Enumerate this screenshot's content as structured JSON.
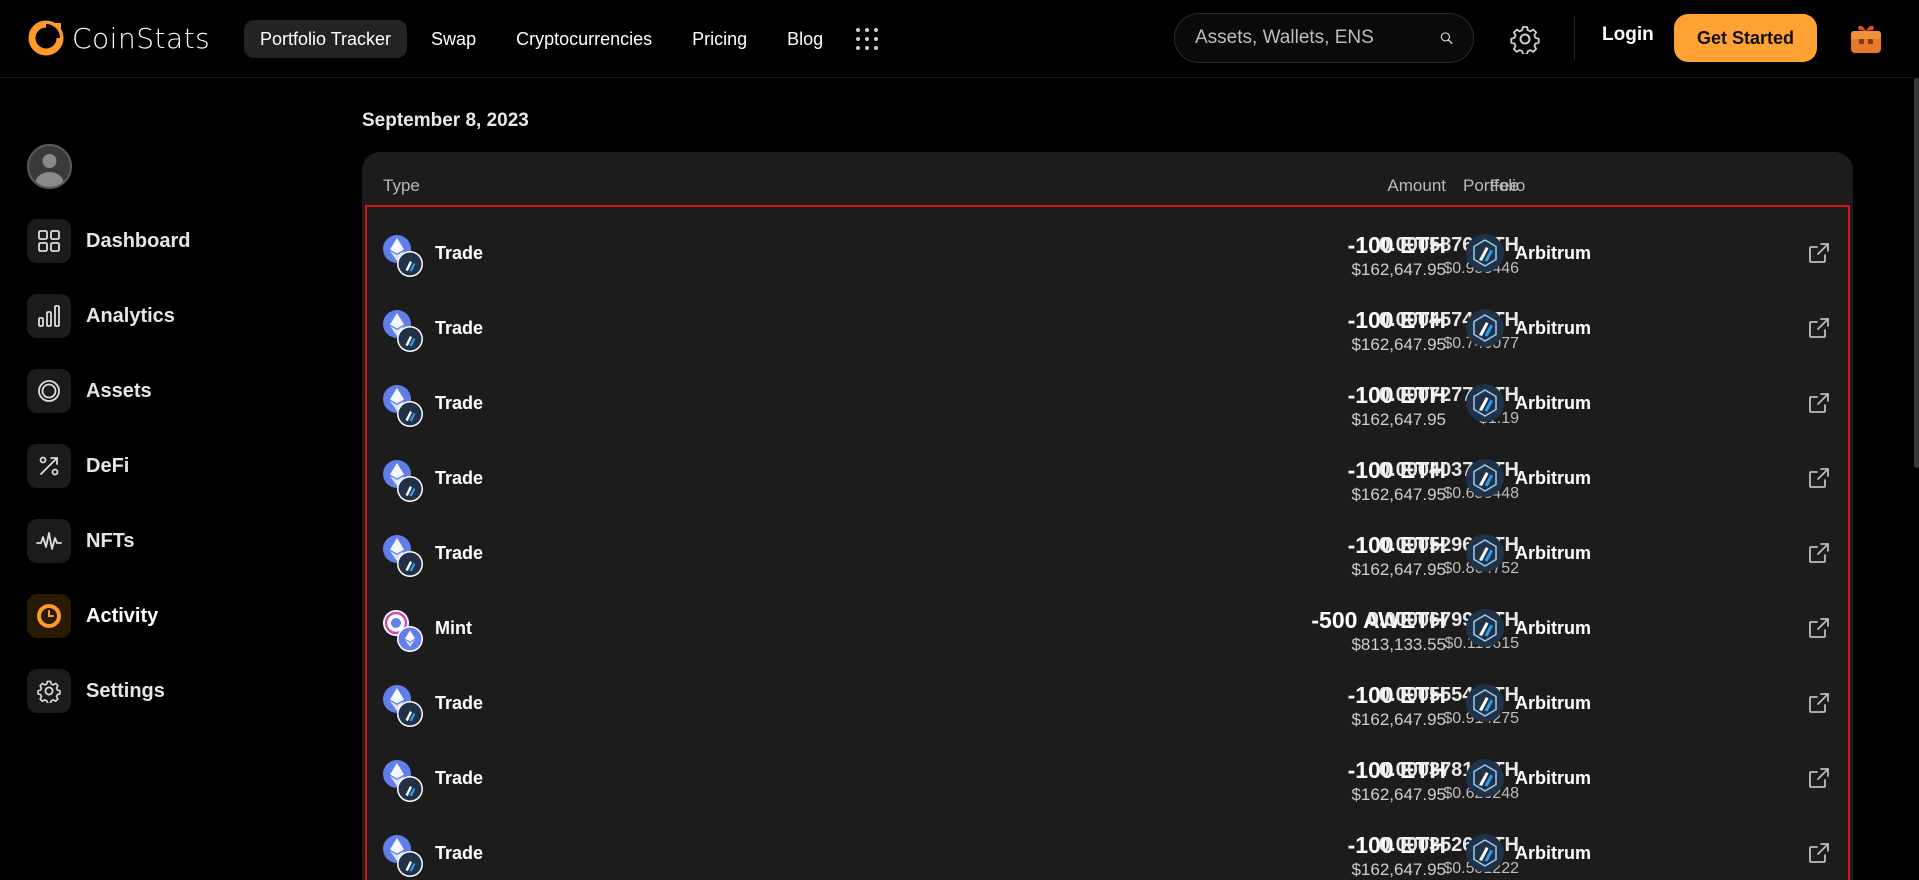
{
  "brand": {
    "name": "CoinStats",
    "accent": "#ffa233"
  },
  "nav": {
    "items": [
      {
        "label": "Portfolio Tracker",
        "active": true
      },
      {
        "label": "Swap"
      },
      {
        "label": "Cryptocurrencies"
      },
      {
        "label": "Pricing"
      },
      {
        "label": "Blog"
      }
    ],
    "more_icon": "grid-dots-icon"
  },
  "search": {
    "placeholder": "Assets, Wallets, ENS"
  },
  "header": {
    "login_label": "Login",
    "cta_label": "Get Started"
  },
  "sidebar": {
    "items": [
      {
        "label": "Dashboard",
        "icon": "dashboard-icon"
      },
      {
        "label": "Analytics",
        "icon": "analytics-icon"
      },
      {
        "label": "Assets",
        "icon": "assets-icon"
      },
      {
        "label": "DeFi",
        "icon": "defi-icon"
      },
      {
        "label": "NFTs",
        "icon": "nfts-icon"
      },
      {
        "label": "Activity",
        "icon": "activity-icon",
        "active": true
      },
      {
        "label": "Settings",
        "icon": "settings-icon"
      }
    ]
  },
  "main": {
    "date": "September 8, 2023",
    "columns": {
      "type": "Type",
      "amount": "Amount",
      "fee": "Fee",
      "portfolio": "Portfolio"
    },
    "rows": [
      {
        "type": "Trade",
        "amount": "-100 ETH",
        "amount_usd": "$162,647.95",
        "fee": "0.0005876 ETH",
        "fee_usd": "$0.958446",
        "portfolio": "Arbitrum"
      },
      {
        "type": "Trade",
        "amount": "-100 ETH",
        "amount_usd": "$162,647.95",
        "fee": "0.0004574 ETH",
        "fee_usd": "$0.746077",
        "portfolio": "Arbitrum"
      },
      {
        "type": "Trade",
        "amount": "-100 ETH",
        "amount_usd": "$162,647.95",
        "fee": "0.0007277 ETH",
        "fee_usd": "$1.19",
        "portfolio": "Arbitrum"
      },
      {
        "type": "Trade",
        "amount": "-100 ETH",
        "amount_usd": "$162,647.95",
        "fee": "0.0004037 ETH",
        "fee_usd": "$0.658448",
        "portfolio": "Arbitrum"
      },
      {
        "type": "Trade",
        "amount": "-100 ETH",
        "amount_usd": "$162,647.95",
        "fee": "0.0005296 ETH",
        "fee_usd": "$0.864752",
        "portfolio": "Arbitrum"
      },
      {
        "type": "Mint",
        "amount": "-500 AWETH",
        "amount_usd": "$813,133.55",
        "fee": "0.00006799 ETH",
        "fee_usd": "$0.110615",
        "portfolio": "Arbitrum"
      },
      {
        "type": "Trade",
        "amount": "-100 ETH",
        "amount_usd": "$162,647.95",
        "fee": "0.0005554 ETH",
        "fee_usd": "$0.914275",
        "portfolio": "Arbitrum"
      },
      {
        "type": "Trade",
        "amount": "-100 ETH",
        "amount_usd": "$162,647.95",
        "fee": "0.0003781 ETH",
        "fee_usd": "$0.623248",
        "portfolio": "Arbitrum"
      },
      {
        "type": "Trade",
        "amount": "-100 ETH",
        "amount_usd": "$162,647.95",
        "fee": "0.0003526 ETH",
        "fee_usd": "$0.581222",
        "portfolio": "Arbitrum"
      }
    ]
  }
}
